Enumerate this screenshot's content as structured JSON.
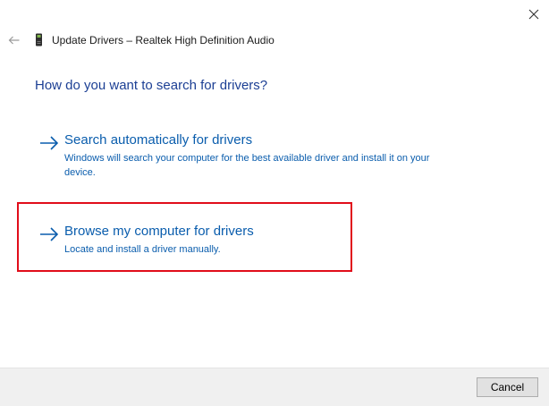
{
  "window": {
    "title": "Update Drivers – Realtek High Definition Audio",
    "close_icon": "close-icon",
    "back_icon": "back-arrow-icon",
    "device_icon": "audio-device-icon"
  },
  "main": {
    "question": "How do you want to search for drivers?",
    "options": [
      {
        "title": "Search automatically for drivers",
        "description": "Windows will search your computer for the best available driver and install it on your device.",
        "icon": "right-arrow-icon"
      },
      {
        "title": "Browse my computer for drivers",
        "description": "Locate and install a driver manually.",
        "icon": "right-arrow-icon"
      }
    ]
  },
  "footer": {
    "cancel_label": "Cancel"
  },
  "colors": {
    "link": "#0a5dad",
    "heading": "#1c3f94",
    "highlight": "#e10d1a",
    "footer_bg": "#f0f0f0"
  }
}
